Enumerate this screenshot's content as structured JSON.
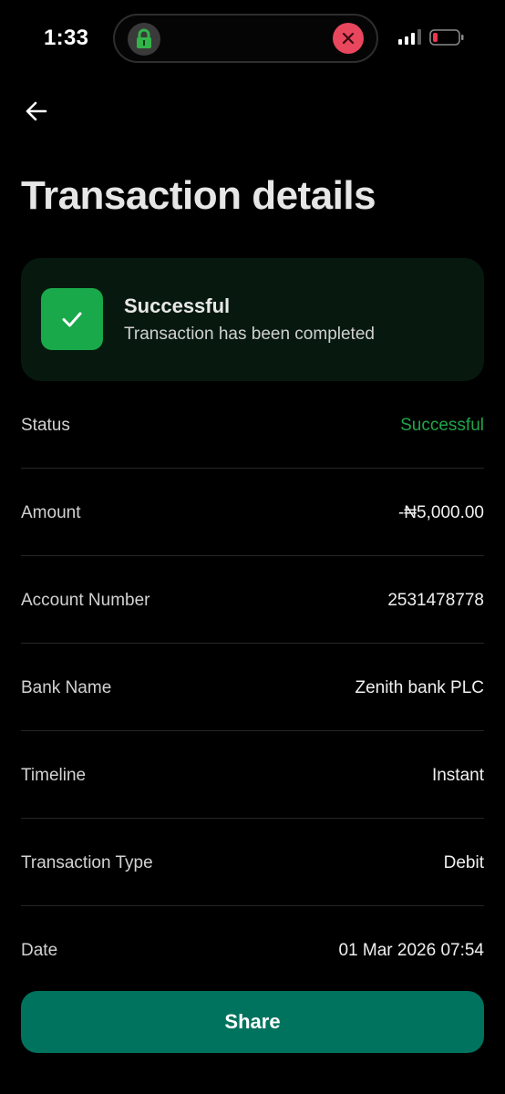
{
  "status_bar": {
    "time": "1:33"
  },
  "header": {
    "title": "Transaction details"
  },
  "status_card": {
    "title": "Successful",
    "subtitle": "Transaction has been completed"
  },
  "details": [
    {
      "label": "Status",
      "value": "Successful"
    },
    {
      "label": "Amount",
      "value": "-₦5,000.00"
    },
    {
      "label": "Account Number",
      "value": "2531478778"
    },
    {
      "label": "Bank Name",
      "value": "Zenith bank PLC"
    },
    {
      "label": "Timeline",
      "value": "Instant"
    },
    {
      "label": "Transaction Type",
      "value": "Debit"
    },
    {
      "label": "Date",
      "value": "01 Mar 2026 07:54"
    }
  ],
  "actions": {
    "share_label": "Share"
  },
  "colors": {
    "background": "#000000",
    "success": "#1fa54a",
    "card_background": "#07190f",
    "share_button": "#00735e"
  },
  "icons": {
    "back": "arrow-left-icon",
    "check": "check-icon",
    "island_lock": "lock-icon",
    "island_close": "close-icon"
  }
}
